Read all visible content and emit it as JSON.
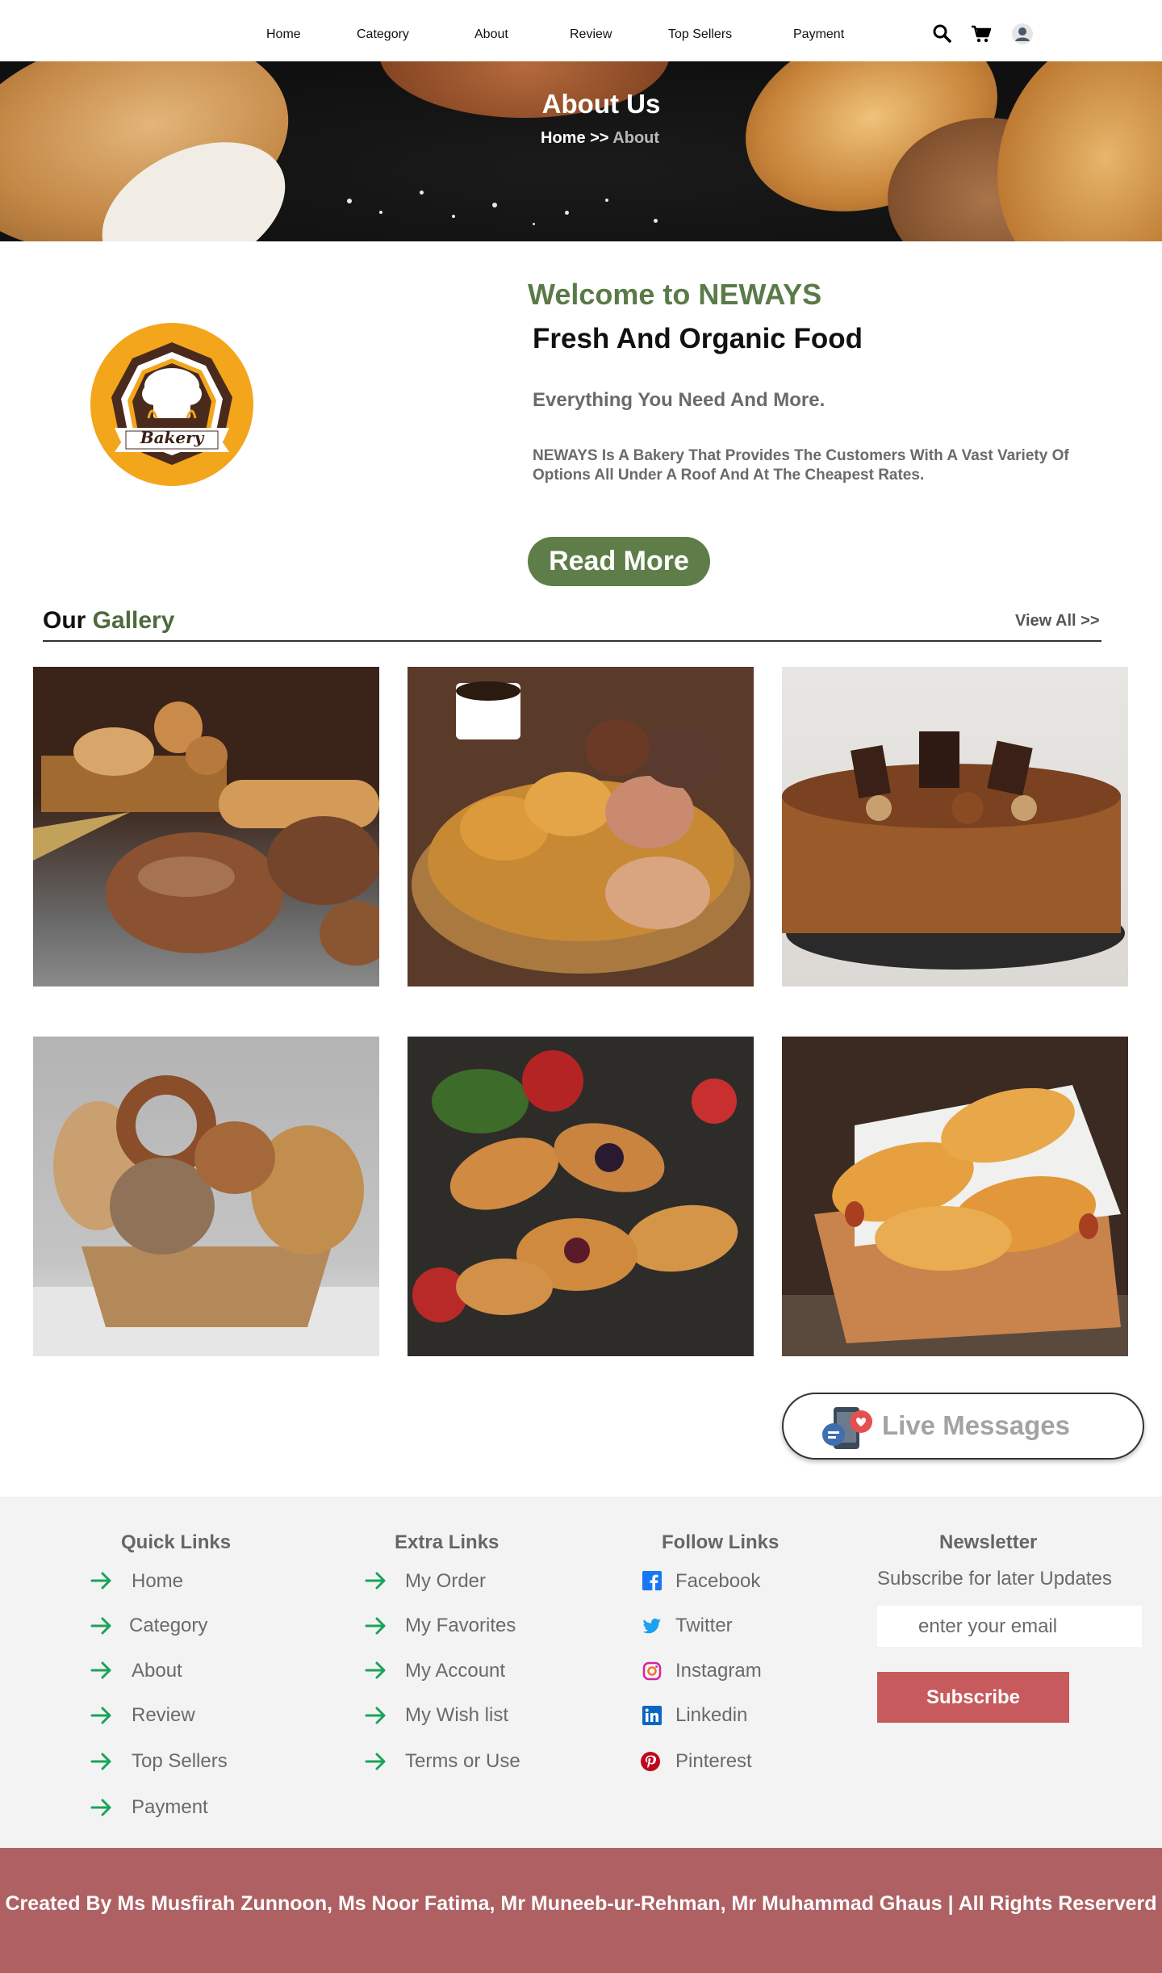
{
  "nav": {
    "items": [
      "Home",
      "Category",
      "About",
      "Review",
      "Top Sellers",
      "Payment"
    ],
    "icons": [
      "search-icon",
      "cart-icon",
      "user-icon"
    ]
  },
  "hero": {
    "title": "About Us",
    "crumb_home": "Home >> ",
    "crumb_current": "About"
  },
  "about": {
    "logo_text": "Bakery",
    "welcome": "Welcome to NEWAYS",
    "heading": "Fresh And Organic Food",
    "subheading": "Everything You Need And More.",
    "description": "NEWAYS Is A Bakery  That Provides The Customers With A Vast Variety Of Options All Under A Roof And At The Cheapest Rates.",
    "read_more": "Read More"
  },
  "gallery": {
    "title_a": "Our ",
    "title_b": "Gallery",
    "view_all": "View All >>",
    "images": [
      "bread-basket",
      "pastry-basket-coffee",
      "chocolate-cake",
      "bagel-basket",
      "croissants-fruit",
      "sausage-rolls"
    ]
  },
  "live": {
    "label": "Live Messages"
  },
  "footer": {
    "quick": {
      "title": "Quick Links",
      "items": [
        "Home",
        "Category",
        "About",
        "Review",
        "Top Sellers",
        "Payment"
      ]
    },
    "extra": {
      "title": "Extra Links",
      "items": [
        "My Order",
        "My Favorites",
        "My Account",
        "My Wish list",
        "Terms or Use"
      ]
    },
    "follow": {
      "title": "Follow Links",
      "items": [
        "Facebook",
        "Twitter",
        "Instagram",
        "Linkedin",
        "Pinterest"
      ]
    },
    "newsletter": {
      "title": "Newsletter",
      "subtitle": "Subscribe for later Updates",
      "placeholder": "enter your email",
      "button": "Subscribe"
    },
    "credit": "Created By Ms Musfirah Zunnoon, Ms Noor Fatima, Mr Muneeb-ur-Rehman, Mr Muhammad Ghaus | All Rights Reserverd"
  },
  "colors": {
    "accent_green": "#5e7d48",
    "link_arrow": "#1aa35a",
    "subscribe": "#c75a5d",
    "credit_bar": "#ae6063"
  }
}
